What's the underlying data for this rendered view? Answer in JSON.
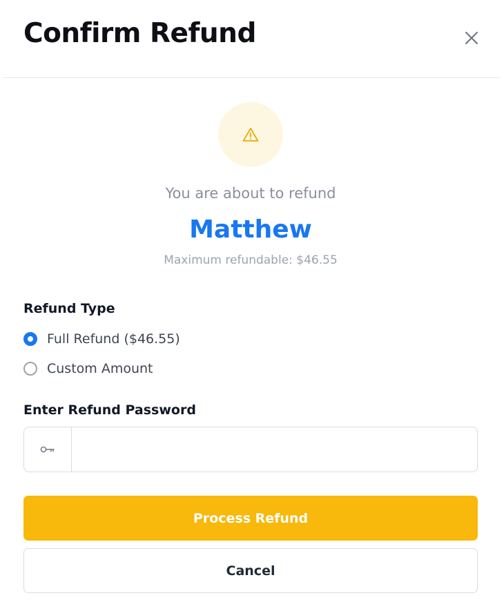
{
  "dialog": {
    "title": "Confirm Refund",
    "close_icon": "close-icon"
  },
  "summary": {
    "icon": "warning-icon",
    "intro": "You are about to refund",
    "customer_name": "Matthew",
    "max_refundable": "Maximum refundable: $46.55"
  },
  "refund_type": {
    "label": "Refund Type",
    "options": [
      {
        "label": "Full Refund ($46.55)",
        "selected": true
      },
      {
        "label": "Custom Amount",
        "selected": false
      }
    ]
  },
  "password": {
    "label": "Enter Refund Password",
    "icon": "key-icon",
    "value": "",
    "placeholder": ""
  },
  "actions": {
    "primary_label": "Process Refund",
    "secondary_label": "Cancel"
  },
  "colors": {
    "accent_blue": "#1877f2",
    "primary_button": "#f8b80c",
    "warning_circle": "#fdf7e1",
    "warning_icon": "#e9a80b"
  }
}
